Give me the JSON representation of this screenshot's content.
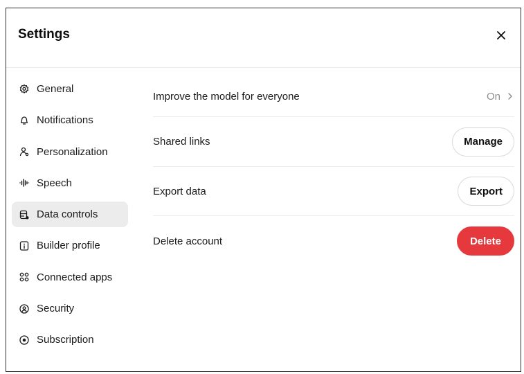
{
  "dialog": {
    "title": "Settings",
    "close_icon": "close-icon"
  },
  "sidebar": {
    "items": [
      {
        "label": "General",
        "icon": "gear-icon",
        "active": false
      },
      {
        "label": "Notifications",
        "icon": "bell-icon",
        "active": false
      },
      {
        "label": "Personalization",
        "icon": "person-icon",
        "active": false
      },
      {
        "label": "Speech",
        "icon": "waveform-icon",
        "active": false
      },
      {
        "label": "Data controls",
        "icon": "database-icon",
        "active": true
      },
      {
        "label": "Builder profile",
        "icon": "id-card-icon",
        "active": false
      },
      {
        "label": "Connected apps",
        "icon": "apps-grid-icon",
        "active": false
      },
      {
        "label": "Security",
        "icon": "shield-icon",
        "active": false
      },
      {
        "label": "Subscription",
        "icon": "subscription-icon",
        "active": false
      }
    ]
  },
  "content": {
    "rows": [
      {
        "label": "Improve the model for everyone",
        "control_type": "link",
        "control_label": "On"
      },
      {
        "label": "Shared links",
        "control_type": "button",
        "control_label": "Manage"
      },
      {
        "label": "Export data",
        "control_type": "button",
        "control_label": "Export"
      },
      {
        "label": "Delete account",
        "control_type": "danger-button",
        "control_label": "Delete"
      }
    ]
  },
  "colors": {
    "danger": "#e5393d",
    "active_nav_bg": "#ececec",
    "muted_text": "#8e8e8e",
    "divider": "#ececec"
  }
}
